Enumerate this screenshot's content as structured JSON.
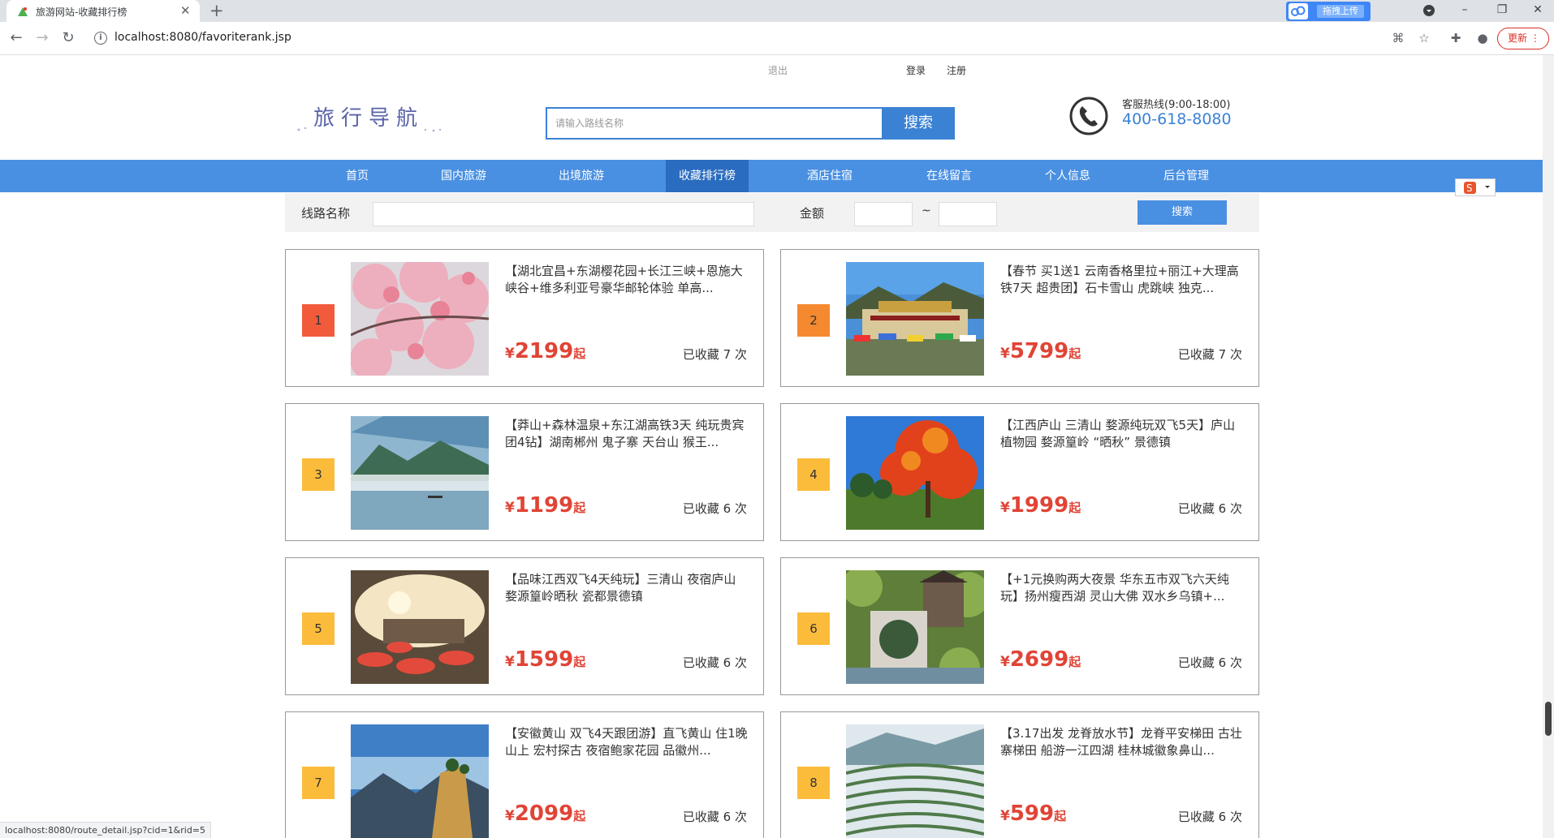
{
  "browser": {
    "tab_title": "旅游网站-收藏排行榜",
    "close_symbol": "✕",
    "new_tab_symbol": "+",
    "upload_label": "拖拽上传",
    "url": "localhost:8080/favoriterank.jsp",
    "update_label": "更新",
    "status_url": "localhost:8080/route_detail.jsp?cid=1&rid=5"
  },
  "header": {
    "logout": "退出",
    "login": "登录",
    "register": "注册",
    "logo_text": "旅行导航",
    "search_placeholder": "请输入路线名称",
    "search_button": "搜索",
    "hotline_label": "客服热线(9:00-18:00)",
    "hotline_number": "400-618-8080"
  },
  "nav": [
    {
      "label": "首页"
    },
    {
      "label": "国内旅游"
    },
    {
      "label": "出境旅游"
    },
    {
      "label": "收藏排行榜"
    },
    {
      "label": "酒店住宿"
    },
    {
      "label": "在线留言"
    },
    {
      "label": "个人信息"
    },
    {
      "label": "后台管理"
    }
  ],
  "filter": {
    "route_label": "线路名称",
    "amount_label": "金额",
    "range_separator": "~",
    "search_button": "搜索"
  },
  "colors": {
    "rank_top": "#f15b3c",
    "rank_other": "#fbbc3c",
    "price": "#e04436",
    "nav_bg": "#4a90e2",
    "nav_active": "#2a6cbf"
  },
  "routes": [
    {
      "rank": "1",
      "title": "【湖北宜昌+东湖樱花园+长江三峡+恩施大峡谷+维多利亚号豪华邮轮体验 单高...",
      "currency": "¥",
      "price": "2199",
      "suffix": "起",
      "favorites": "已收藏 7 次",
      "image": "cherry-blossom"
    },
    {
      "rank": "2",
      "title": "【春节 买1送1 云南香格里拉+丽江+大理高铁7天 超贵团】石卡雪山 虎跳峡 独克...",
      "currency": "¥",
      "price": "5799",
      "suffix": "起",
      "favorites": "已收藏 7 次",
      "image": "tibetan-monastery"
    },
    {
      "rank": "3",
      "title": "【莽山+森林温泉+东江湖高铁3天 纯玩贵宾团4钻】湖南郴州 鬼子寨 天台山 猴王...",
      "currency": "¥",
      "price": "1199",
      "suffix": "起",
      "favorites": "已收藏 6 次",
      "image": "misty-lake"
    },
    {
      "rank": "4",
      "title": "【江西庐山 三清山 婺源纯玩双飞5天】庐山植物园 婺源篁岭 “晒秋” 景德镇",
      "currency": "¥",
      "price": "1999",
      "suffix": "起",
      "favorites": "已收藏 6 次",
      "image": "autumn-tree"
    },
    {
      "rank": "5",
      "title": "【品味江西双飞4天纯玩】三清山 夜宿庐山 婺源篁岭晒秋 瓷都景德镇",
      "currency": "¥",
      "price": "1599",
      "suffix": "起",
      "favorites": "已收藏 6 次",
      "image": "village-sunset"
    },
    {
      "rank": "6",
      "title": "【+1元换购两大夜景 华东五市双飞六天纯玩】扬州瘦西湖 灵山大佛 双水乡乌镇+...",
      "currency": "¥",
      "price": "2699",
      "suffix": "起",
      "favorites": "已收藏 6 次",
      "image": "garden-moon-gate"
    },
    {
      "rank": "7",
      "title": "【安徽黄山 双飞4天跟团游】直飞黄山 住1晚山上 宏村探古 夜宿鲍家花园 品徽州...",
      "currency": "¥",
      "price": "2099",
      "suffix": "起",
      "favorites": "已收藏 6 次",
      "image": "yellow-mountain"
    },
    {
      "rank": "8",
      "title": "【3.17出发 龙脊放水节】龙脊平安梯田 古壮寨梯田 船游一江四湖 桂林城徽象鼻山...",
      "currency": "¥",
      "price": "599",
      "suffix": "起",
      "favorites": "已收藏 6 次",
      "image": "rice-terraces"
    }
  ]
}
